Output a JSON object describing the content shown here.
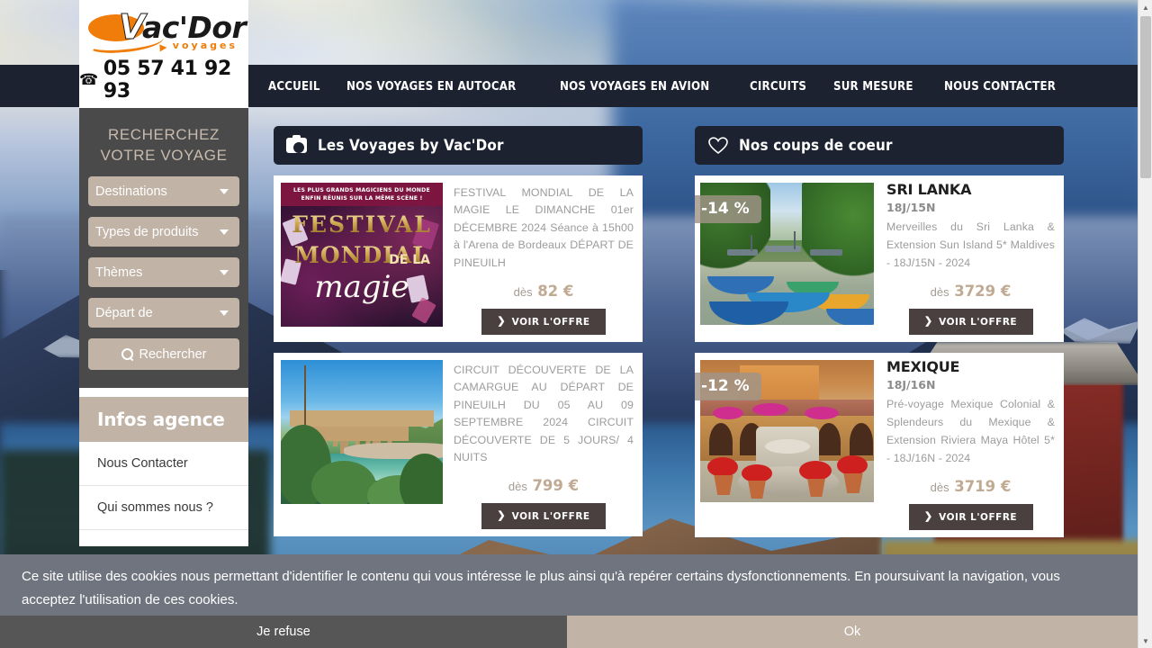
{
  "header": {
    "logo": {
      "v_letter": "V",
      "word": "ac'Dor",
      "tagline": "voyages",
      "phone": "05 57 41 92 93",
      "phone_icon": "phone-icon"
    },
    "nav": [
      {
        "label": "ACCUEIL"
      },
      {
        "label": "NOS VOYAGES EN AUTOCAR"
      },
      {
        "label": "NOS VOYAGES EN AVION"
      },
      {
        "label": "CIRCUITS"
      },
      {
        "label": "SUR MESURE"
      },
      {
        "label": "NOUS CONTACTER"
      }
    ]
  },
  "sidebar": {
    "search": {
      "title_line1": "RECHERCHEZ",
      "title_line2": "VOTRE VOYAGE",
      "fields": [
        {
          "label": "Destinations",
          "icon": "chevron-down-icon"
        },
        {
          "label": "Types de produits",
          "icon": "chevron-down-icon"
        },
        {
          "label": "Thèmes",
          "icon": "chevron-down-icon"
        },
        {
          "label": "Départ de",
          "icon": "chevron-down-icon"
        }
      ],
      "button_label": "Rechercher",
      "button_icon": "search-icon"
    },
    "infos": {
      "title": "Infos agence",
      "items": [
        {
          "label": "Nous Contacter"
        },
        {
          "label": "Qui sommes nous ?"
        }
      ]
    }
  },
  "panels": {
    "left": {
      "icon": "camera-icon",
      "title": "Les Voyages by Vac'Dor",
      "cards": [
        {
          "image": "magic-festival-poster",
          "poster": {
            "band_line1": "LES PLUS GRANDS MAGICIENS DU MONDE",
            "band_line2": "ENFIN RÉUNIS SUR LA MÊME SCÈNE !",
            "title1": "FESTIVAL",
            "title2": "MONDIAL",
            "of_the": "DE LA",
            "title3": "magie"
          },
          "description": "FESTIVAL MONDIAL DE LA MAGIE LE DIMANCHE 01er DÉCEMBRE 2024 Séance à 15h00 à l'Arena de Bordeaux DÉPART DE PINEUILH",
          "price_prefix": "dès",
          "price": "82 €",
          "button_label": "VOIR L'OFFRE"
        },
        {
          "image": "pont-du-gard-aqueduct",
          "description": "CIRCUIT DÉCOUVERTE DE LA CAMARGUE AU DÉPART DE PINEUILH DU 05 AU 09 SEPTEMBRE 2024 CIRCUIT DÉCOUVERTE DE 5 JOURS/ 4 NUITS",
          "price_prefix": "dès",
          "price": "799 €",
          "button_label": "VOIR L'OFFRE"
        }
      ]
    },
    "right": {
      "icon": "heart-icon",
      "title": "Nos coups de coeur",
      "cards": [
        {
          "image": "sri-lanka-fishing-boats",
          "badge": "-14 %",
          "title": "SRI LANKA",
          "subtitle": "18J/15N",
          "description": "Merveilles du Sri Lanka & Extension Sun Island 5* Maldives - 18J/15N - 2024",
          "price_prefix": "dès",
          "price": "3729 €",
          "button_label": "VOIR L'OFFRE"
        },
        {
          "image": "mexique-courtyard-fountain",
          "badge": "-12 %",
          "title": "MEXIQUE",
          "subtitle": "18J/16N",
          "description": "Pré-voyage Mexique Colonial & Splendeurs du Mexique & Extension Riviera Maya Hôtel 5* - 18J/16N - 2024",
          "price_prefix": "dès",
          "price": "3719 €",
          "button_label": "VOIR L'OFFRE"
        }
      ]
    }
  },
  "cookie_banner": {
    "message": "Ce site utilise des cookies nous permettant d'identifier le contenu qui vous intéresse le plus ainsi qu'à repérer certains dysfonctionnements. En poursuivant la navigation, vous acceptez l'utilisation de ces cookies.",
    "refuse_label": "Je refuse",
    "accept_label": "Ok"
  },
  "colors": {
    "nav_bg": "#1c2230",
    "sidebar_bg": "#4a4a4a",
    "accent_tan": "#c1b3a6",
    "logo_orange": "#f07d0a",
    "button_dark": "#4a4040",
    "price_text": "#c0aa93",
    "cookie_bg": "#70747f"
  }
}
